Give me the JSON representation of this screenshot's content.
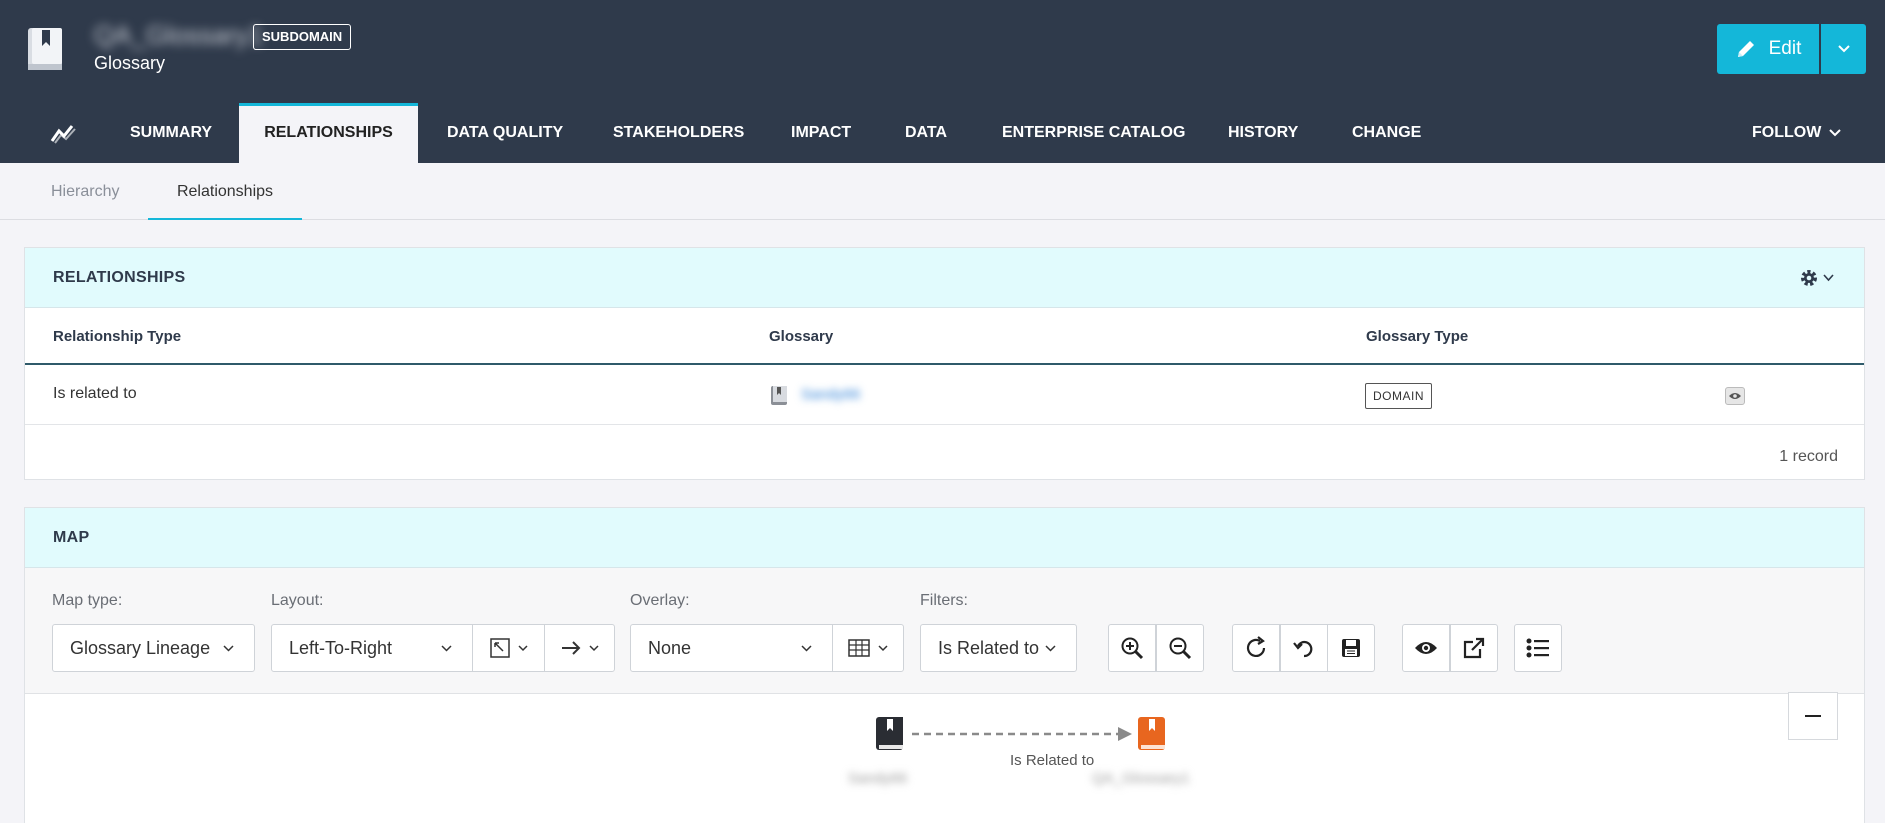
{
  "header": {
    "asset_name": "QA_Glossary1",
    "asset_type": "Glossary",
    "badge": "SUBDOMAIN",
    "edit_label": "Edit",
    "accent_color": "#14b7d9",
    "bg_color": "#2f3a4b"
  },
  "tabs": [
    {
      "label": "SUMMARY"
    },
    {
      "label": "RELATIONSHIPS"
    },
    {
      "label": "DATA QUALITY"
    },
    {
      "label": "STAKEHOLDERS"
    },
    {
      "label": "IMPACT"
    },
    {
      "label": "DATA"
    },
    {
      "label": "ENTERPRISE CATALOG"
    },
    {
      "label": "HISTORY"
    },
    {
      "label": "CHANGE"
    }
  ],
  "active_tab": "RELATIONSHIPS",
  "follow_label": "FOLLOW",
  "subtabs": [
    {
      "label": "Hierarchy"
    },
    {
      "label": "Relationships"
    }
  ],
  "relationships": {
    "title": "RELATIONSHIPS",
    "columns": [
      "Relationship Type",
      "Glossary",
      "Glossary Type"
    ],
    "rows": [
      {
        "type": "Is related to",
        "glossary": "Sandy66",
        "glossary_type": "DOMAIN"
      }
    ],
    "record_count": "1 record"
  },
  "map": {
    "title": "MAP",
    "map_type_label": "Map type:",
    "map_type_value": "Glossary Lineage",
    "layout_label": "Layout:",
    "layout_value": "Left-To-Right",
    "overlay_label": "Overlay:",
    "overlay_value": "None",
    "filters_label": "Filters:",
    "filters_value": "Is Related to",
    "source_node": "Sandy66",
    "target_node": "QA_Glossary1",
    "edge_label": "Is Related to",
    "target_color": "#e8661f"
  }
}
